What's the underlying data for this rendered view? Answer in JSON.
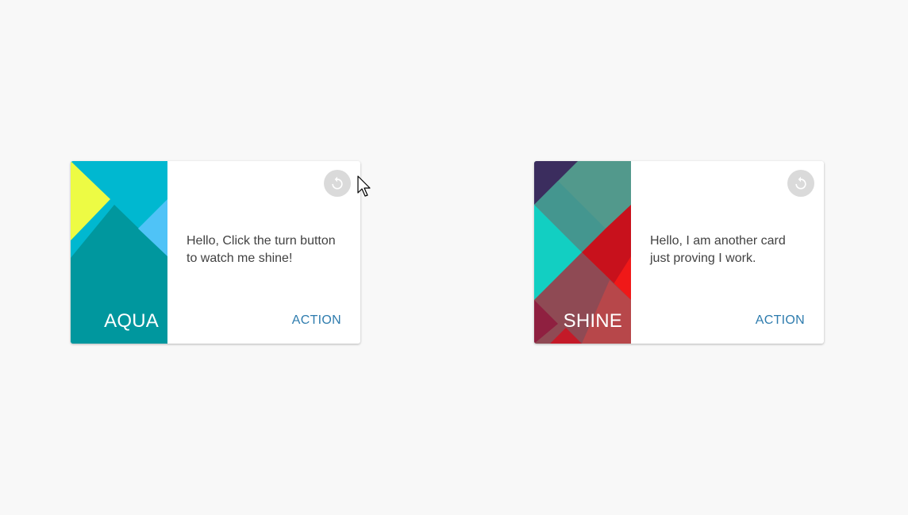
{
  "cards": [
    {
      "media_title": "AQUA",
      "text": "Hello, Click the turn button to watch me shine!",
      "action_label": "ACTION",
      "turn_icon": "rotate-left-icon",
      "palette": [
        "#00b8d0",
        "#00979e",
        "#edfb44",
        "#4fc3f7"
      ]
    },
    {
      "media_title": "SHINE",
      "text": "Hello, I am another card just proving I work.",
      "action_label": "ACTION",
      "turn_icon": "rotate-left-icon",
      "palette": [
        "#3b2d5e",
        "#52998c",
        "#12cfc2",
        "#c8111c",
        "#f01818",
        "#8f4a54",
        "#b7474a"
      ]
    }
  ],
  "colors": {
    "page_background": "#f8f8f8",
    "action_text": "#2e7cae",
    "turn_button_bg": "#dadada"
  }
}
